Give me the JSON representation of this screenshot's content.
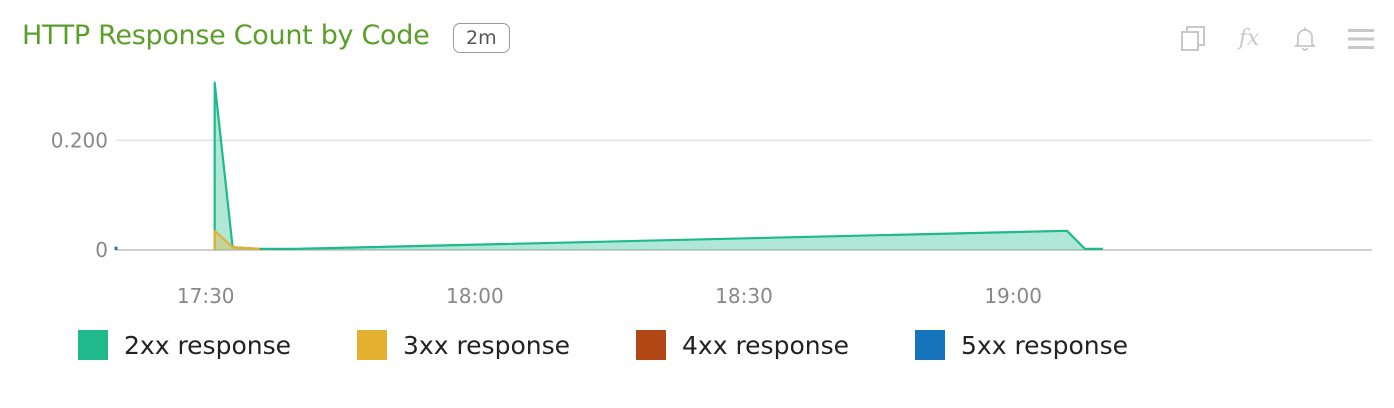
{
  "header": {
    "title": "HTTP Response Count by Code",
    "badge": "2m",
    "toolbar": [
      {
        "name": "copy-icon"
      },
      {
        "name": "fx-icon",
        "glyph": "fx"
      },
      {
        "name": "bell-icon"
      },
      {
        "name": "menu-icon"
      }
    ]
  },
  "colors": {
    "title": "#5b9e2a",
    "2xx": "#1fb98b",
    "3xx": "#e4b02f",
    "4xx": "#b24716",
    "5xx": "#1674bd"
  },
  "chart_data": {
    "type": "area",
    "x_unit": "time (HH:MM)",
    "xlim": [
      "17:20",
      "19:40"
    ],
    "ylim": [
      0,
      0.31
    ],
    "y_ticks": [
      {
        "value": 0,
        "label": "0"
      },
      {
        "value": 0.2,
        "label": "0.200"
      }
    ],
    "x_ticks": [
      {
        "time": "17:30",
        "label": "17:30"
      },
      {
        "time": "18:00",
        "label": "18:00"
      },
      {
        "time": "18:30",
        "label": "18:30"
      },
      {
        "time": "19:00",
        "label": "19:00"
      }
    ],
    "grid": true,
    "legend_position": "bottom",
    "series": [
      {
        "name": "2xx response",
        "color": "#1fb98b",
        "points": [
          [
            "17:31",
            0
          ],
          [
            "17:31",
            0.305
          ],
          [
            "17:33",
            0.005
          ],
          [
            "17:36",
            0.002
          ],
          [
            "17:40",
            0.002
          ],
          [
            "19:06",
            0.035
          ],
          [
            "19:08",
            0.002
          ],
          [
            "19:10",
            0.002
          ]
        ]
      },
      {
        "name": "3xx response",
        "color": "#e4b02f",
        "points": [
          [
            "17:31",
            0
          ],
          [
            "17:31",
            0.035
          ],
          [
            "17:33",
            0.005
          ],
          [
            "17:36",
            0.002
          ]
        ]
      },
      {
        "name": "4xx response",
        "color": "#b24716",
        "points": []
      },
      {
        "name": "5xx response",
        "color": "#1674bd",
        "points": [
          [
            "17:20",
            0.006
          ],
          [
            "17:20",
            0
          ]
        ]
      }
    ]
  },
  "legend": [
    {
      "label": "2xx response",
      "color": "#1fb98b"
    },
    {
      "label": "3xx response",
      "color": "#e4b02f"
    },
    {
      "label": "4xx response",
      "color": "#b24716"
    },
    {
      "label": "5xx response",
      "color": "#1674bd"
    }
  ]
}
